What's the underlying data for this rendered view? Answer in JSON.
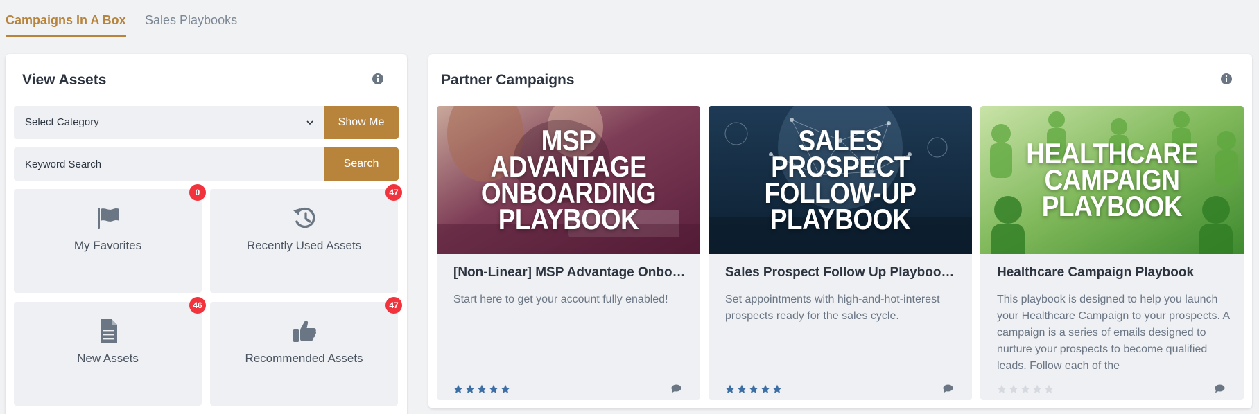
{
  "tabs": [
    {
      "label": "Campaigns In A Box",
      "active": true
    },
    {
      "label": "Sales Playbooks",
      "active": false
    }
  ],
  "view_assets": {
    "title": "View Assets",
    "category_select": {
      "value": "Select Category"
    },
    "show_me_label": "Show Me",
    "keyword_search": {
      "placeholder": "Keyword Search"
    },
    "search_label": "Search",
    "tiles": [
      {
        "label": "My Favorites",
        "count": "0",
        "icon": "flag-icon"
      },
      {
        "label": "Recently Used Assets",
        "count": "47",
        "icon": "history-icon"
      },
      {
        "label": "New Assets",
        "count": "46",
        "icon": "document-icon"
      },
      {
        "label": "Recommended Assets",
        "count": "47",
        "icon": "thumbs-up-icon"
      }
    ]
  },
  "partner_campaigns": {
    "title": "Partner Campaigns",
    "cards": [
      {
        "hero_text": "MSP ADVANTAGE\nONBOARDING\nPLAYBOOK",
        "title": "[Non-Linear] MSP Advantage Onboarding Playbook",
        "description": "Start here to get your account fully enabled!",
        "rating": 5
      },
      {
        "hero_text": "SALES PROSPECT\nFOLLOW-UP\nPLAYBOOK",
        "title": "Sales Prospect Follow Up Playbook Campaign",
        "description": "Set appointments with high-and-hot-interest prospects ready for the sales cycle.",
        "rating": 5
      },
      {
        "hero_text": "HEALTHCARE\nCAMPAIGN\nPLAYBOOK",
        "title": "Healthcare Campaign Playbook",
        "description": "This playbook is designed to help you launch your Healthcare Campaign to your prospects. A campaign is a series of emails designed to nurture your prospects to become qualified leads. Follow each of the",
        "rating": 0
      }
    ]
  },
  "colors": {
    "accent_gold": "#b8843c",
    "badge_red": "#f0333c",
    "star_blue": "#3a6ea5",
    "star_empty": "#d6dae0"
  }
}
